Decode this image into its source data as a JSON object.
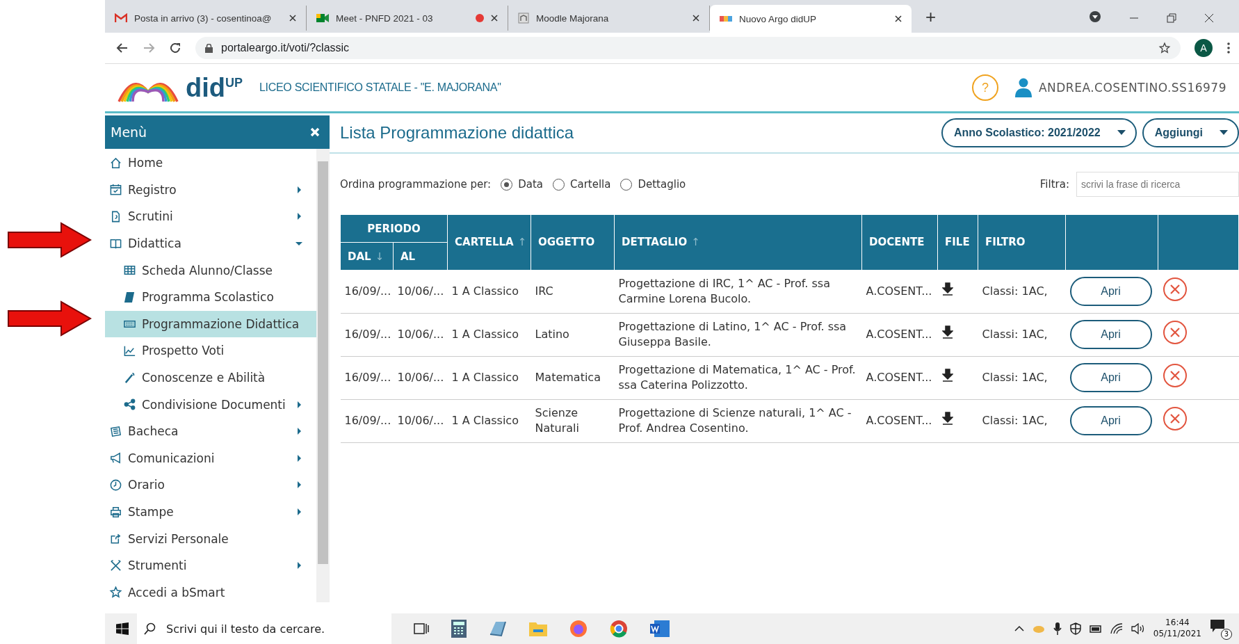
{
  "browser": {
    "tabs": [
      {
        "kind": "mail",
        "label": "Posta in arrivo (3) - cosentinoa@",
        "selected": false,
        "recording": false
      },
      {
        "kind": "meet",
        "label": "Meet - PNFD 2021 - 03",
        "selected": false,
        "recording": true
      },
      {
        "kind": "moodle",
        "label": "Moodle Majorana",
        "selected": false,
        "recording": false
      },
      {
        "kind": "argo",
        "label": "Nuovo Argo didUP",
        "selected": true,
        "recording": false
      }
    ],
    "new_tab": "+",
    "url": "portaleargo.it/voti/?classic",
    "profile": "A"
  },
  "header": {
    "logo": "did",
    "logo_sup": "UP",
    "school": "LICEO SCIENTIFICO STATALE - \"E. MAJORANA\"",
    "help": "?",
    "user": "ANDREA.COSENTINO.SS16979"
  },
  "menu": {
    "title": "Menù",
    "items": [
      {
        "kind": "home",
        "label": "Home",
        "submenu": false,
        "selected": false
      },
      {
        "kind": "calendar",
        "label": "Registro",
        "submenu": true,
        "expanded": false,
        "selected": false
      },
      {
        "kind": "doc",
        "label": "Scrutini",
        "submenu": true,
        "expanded": false,
        "selected": false
      },
      {
        "kind": "book",
        "label": "Didattica",
        "submenu": true,
        "expanded": true,
        "selected": false,
        "children": [
          {
            "kind": "table",
            "label": "Scheda Alunno/Classe",
            "submenu": false,
            "selected": false
          },
          {
            "kind": "notebook",
            "label": "Programma Scolastico",
            "submenu": false,
            "selected": false
          },
          {
            "kind": "keyboard",
            "label": "Programmazione Didattica",
            "submenu": false,
            "selected": true
          },
          {
            "kind": "chart",
            "label": "Prospetto Voti",
            "submenu": false,
            "selected": false
          },
          {
            "kind": "wand",
            "label": "Conoscenze e Abilità",
            "submenu": false,
            "selected": false
          },
          {
            "kind": "share",
            "label": "Condivisione Documenti",
            "submenu": true,
            "expanded": false,
            "selected": false
          }
        ]
      },
      {
        "kind": "news",
        "label": "Bacheca",
        "submenu": true,
        "expanded": false,
        "selected": false
      },
      {
        "kind": "megaphone",
        "label": "Comunicazioni",
        "submenu": true,
        "expanded": false,
        "selected": false
      },
      {
        "kind": "clock",
        "label": "Orario",
        "submenu": true,
        "expanded": false,
        "selected": false
      },
      {
        "kind": "printer",
        "label": "Stampe",
        "submenu": true,
        "expanded": false,
        "selected": false
      },
      {
        "kind": "export",
        "label": "Servizi Personale",
        "submenu": false,
        "selected": false
      },
      {
        "kind": "tools",
        "label": "Strumenti",
        "submenu": true,
        "expanded": false,
        "selected": false
      },
      {
        "kind": "star",
        "label": "Accedi a bSmart",
        "submenu": false,
        "selected": false
      }
    ]
  },
  "page": {
    "title": "Lista Programmazione didattica",
    "buttons": [
      "Anno Scolastico: 2021/2022",
      "Aggiungi"
    ],
    "sort_label": "Ordina programmazione per:",
    "sort_options": [
      {
        "label": "Data",
        "selected": true
      },
      {
        "label": "Cartella",
        "selected": false
      },
      {
        "label": "Dettaglio",
        "selected": false
      }
    ],
    "filter_label": "Filtra:",
    "filter_placeholder": "scrivi la frase di ricerca"
  },
  "table": {
    "group": "PERIODO",
    "columns": [
      {
        "label": "DAL",
        "arrow": "↓"
      },
      {
        "label": "AL"
      },
      {
        "label": "CARTELLA",
        "arrow": "↑"
      },
      {
        "label": "OGGETTO"
      },
      {
        "label": "DETTAGLIO",
        "arrow": "↑"
      },
      {
        "label": "DOCENTE"
      },
      {
        "label": "FILE"
      },
      {
        "label": "FILTRO"
      }
    ],
    "rows": [
      {
        "dal": "16/09/...",
        "al": "10/06/...",
        "cartella": "1 A Classico",
        "oggetto": "IRC",
        "dettaglio": "Progettazione di IRC, 1^ AC - Prof. ssa Carmine Lorena Bucolo.",
        "docente": "A.COSENT...",
        "filtro": "Classi: 1AC,",
        "action": "Apri"
      },
      {
        "dal": "16/09/...",
        "al": "10/06/...",
        "cartella": "1 A Classico",
        "oggetto": "Latino",
        "dettaglio": "Progettazione di Latino, 1^ AC - Prof. ssa Giuseppa Basile.",
        "docente": "A.COSENT...",
        "filtro": "Classi: 1AC,",
        "action": "Apri"
      },
      {
        "dal": "16/09/...",
        "al": "10/06/...",
        "cartella": "1 A Classico",
        "oggetto": "Matematica",
        "dettaglio": "Progettazione di Matematica, 1^ AC - Prof. ssa Caterina Polizzotto.",
        "docente": "A.COSENT...",
        "filtro": "Classi: 1AC,",
        "action": "Apri"
      },
      {
        "dal": "16/09/...",
        "al": "10/06/...",
        "cartella": "1 A Classico",
        "oggetto": "Scienze Naturali",
        "dettaglio": "Progettazione di Scienze naturali, 1^ AC - Prof. Andrea Cosentino.",
        "docente": "A.COSENT...",
        "filtro": "Classi: 1AC,",
        "action": "Apri"
      }
    ]
  },
  "taskbar": {
    "search_placeholder": "Scrivi qui il testo da cercare.",
    "time": "16:44",
    "date": "05/11/2021",
    "notifications": "3"
  }
}
